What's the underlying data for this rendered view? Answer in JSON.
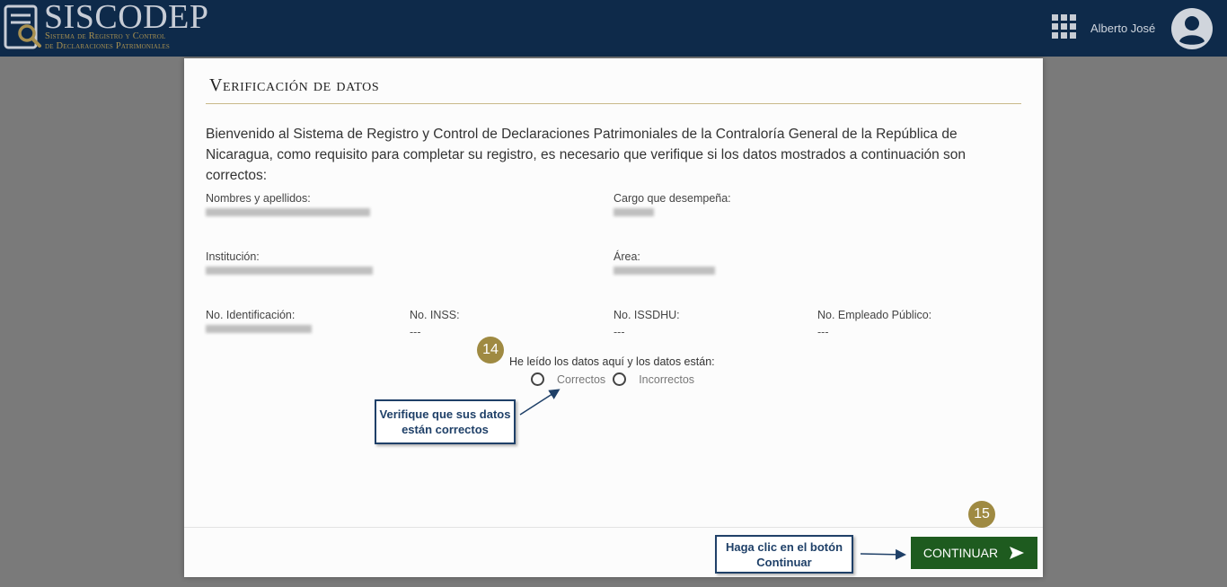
{
  "header": {
    "logo_title": "SISCODEP",
    "logo_subtitle_1": "Sistema de Registro y Control",
    "logo_subtitle_2": "de Declaraciones Patrimoniales",
    "username": "Alberto José"
  },
  "modal": {
    "title": "Verificación de datos",
    "intro": "Bienvenido al Sistema de Registro y Control de Declaraciones Patrimoniales de la Contraloría General de la República de Nicaragua, como requisito para completar su registro, es necesario que verifique si los datos mostrados a continuación son correctos:",
    "fields": {
      "nombres_label": "Nombres y apellidos:",
      "cargo_label": "Cargo que desempeña:",
      "institucion_label": "Institución:",
      "area_label": "Área:",
      "identificacion_label": "No. Identificación:",
      "inss_label": "No. INSS:",
      "inss_value": "---",
      "issdhu_label": "No. ISSDHU:",
      "issdhu_value": "---",
      "empleado_label": "No. Empleado Público:",
      "empleado_value": "---"
    },
    "question": "He leído los datos aquí y los datos están:",
    "options": [
      "Correctos",
      "Incorrectos"
    ],
    "continue_label": "CONTINUAR"
  },
  "annotations": {
    "step_14": "14",
    "step_15": "15",
    "callout_1": "Verifique que sus datos están correctos",
    "callout_2": "Haga clic en el botón Continuar"
  },
  "colors": {
    "header_bg": "#0e2a4a",
    "accent_gold": "#9f8a42",
    "button_green": "#1e5b1f",
    "callout_blue": "#1f4068"
  }
}
